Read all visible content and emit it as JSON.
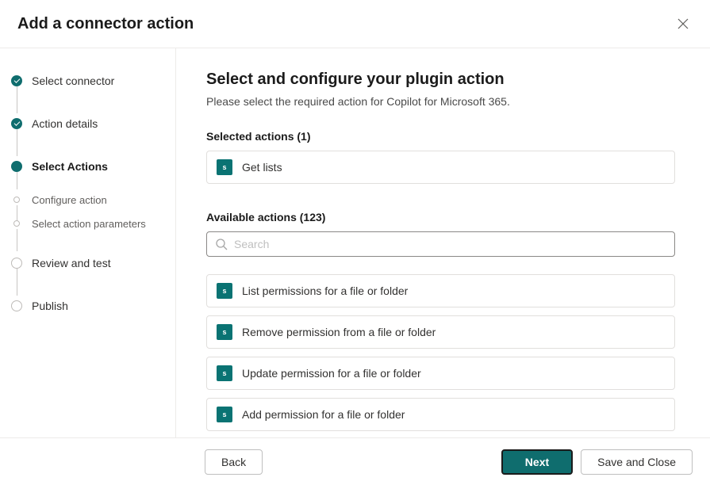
{
  "header": {
    "title": "Add a connector action"
  },
  "steps": [
    {
      "label": "Select connector",
      "state": "done"
    },
    {
      "label": "Action details",
      "state": "done"
    },
    {
      "label": "Select Actions",
      "state": "current"
    },
    {
      "label": "Configure action",
      "state": "sub"
    },
    {
      "label": "Select action parameters",
      "state": "sub"
    },
    {
      "label": "Review and test",
      "state": "hollow"
    },
    {
      "label": "Publish",
      "state": "hollow"
    }
  ],
  "main": {
    "title": "Select and configure your plugin action",
    "subtitle": "Please select the required action for Copilot for Microsoft 365.",
    "selected_label": "Selected actions (1)",
    "selected_actions": [
      {
        "name": "Get lists"
      }
    ],
    "available_label": "Available actions (123)",
    "search_placeholder": "Search",
    "available_actions": [
      {
        "name": "List permissions for a file or folder"
      },
      {
        "name": "Remove permission from a file or folder"
      },
      {
        "name": "Update permission for a file or folder"
      },
      {
        "name": "Add permission for a file or folder"
      }
    ]
  },
  "footer": {
    "back": "Back",
    "next": "Next",
    "save_close": "Save and Close"
  },
  "icon_label": "s"
}
